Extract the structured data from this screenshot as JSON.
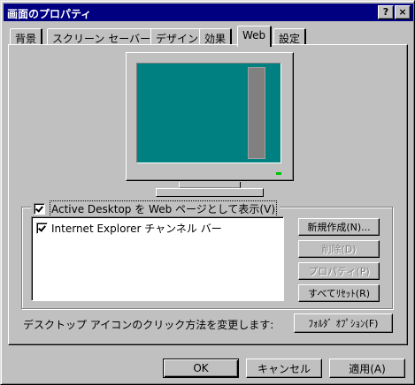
{
  "window": {
    "title": "画面のプロパティ",
    "help_label": "?",
    "close_label": "×"
  },
  "tabs": [
    {
      "label": "背景"
    },
    {
      "label": "スクリーン セーバー"
    },
    {
      "label": "デザイン"
    },
    {
      "label": "効果"
    },
    {
      "label": "Web",
      "active": true
    },
    {
      "label": "設定"
    }
  ],
  "web": {
    "active_desktop_label": "Active Desktop を Web ページとして表示(V)",
    "active_desktop_checked": true,
    "list_items": [
      {
        "label": "Internet Explorer チャンネル バー",
        "checked": true
      }
    ],
    "buttons": {
      "new": "新規作成(N)...",
      "delete": "削除(D)",
      "properties": "プロパティ(P)",
      "reset_all": "すべてﾘｾｯﾄ(R)"
    },
    "desktop_icon_text": "デスクトップ アイコンのクリック方法を変更します:",
    "folder_options": "ﾌｫﾙﾀﾞ ｵﾌﾟｼｮﾝ(F)"
  },
  "footer": {
    "ok": "OK",
    "cancel": "キャンセル",
    "apply": "適用(A)"
  },
  "colors": {
    "titlebar": "#000080",
    "face": "#c0c0c0",
    "desktop_teal": "#008080"
  }
}
